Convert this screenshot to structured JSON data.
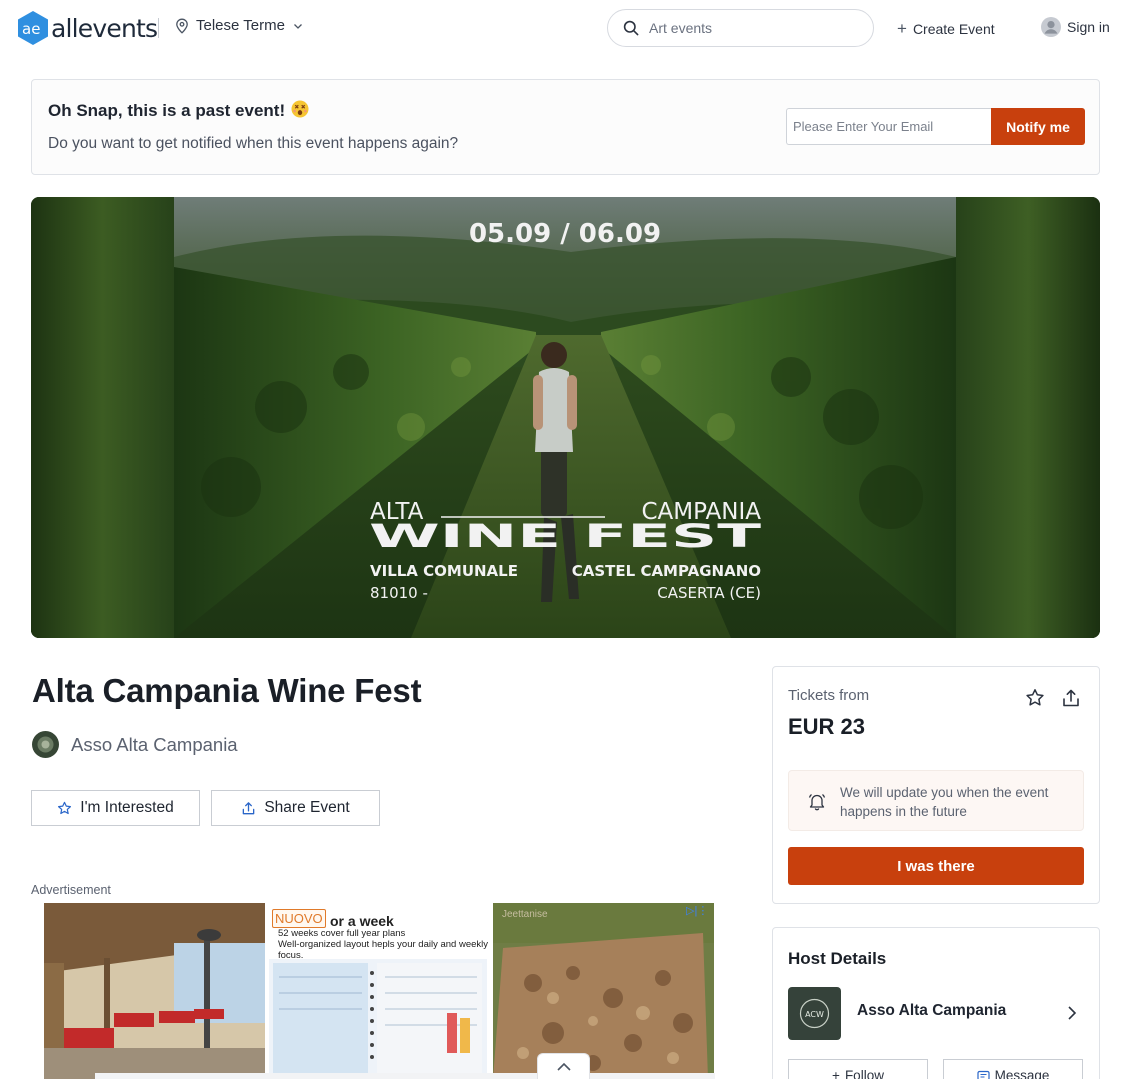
{
  "header": {
    "logo_text": "allevents",
    "location": "Telese Terme",
    "search_placeholder": "Art events",
    "create_event": "Create Event",
    "sign_in": "Sign in"
  },
  "notice": {
    "title": "Oh Snap, this is a past event!",
    "subtitle": "Do you want to get notified when this event happens again?",
    "email_placeholder": "Please Enter Your Email",
    "notify_button": "Notify me"
  },
  "hero": {
    "dates": "05.09 / 06.09",
    "line_left": "ALTA",
    "line_right": "CAMPANIA",
    "big_title": "WINE FEST",
    "venue_left_1": "VILLA COMUNALE",
    "venue_left_2": "81010 -",
    "venue_right_1": "CASTEL CAMPAGNANO",
    "venue_right_2": "CASERTA (CE)"
  },
  "event": {
    "title": "Alta Campania Wine Fest",
    "organizer": "Asso Alta Campania",
    "interested_button": "I'm Interested",
    "share_button": "Share Event"
  },
  "ad": {
    "label": "Advertisement",
    "badge": "NUOVO",
    "headline": "or a week",
    "line2": "52 weeks cover full year plans",
    "line3": "Well-organized layout hepls your daily and weekly focus.",
    "watermark": "Jeettanise"
  },
  "tickets": {
    "from_label": "Tickets from",
    "price": "EUR 23",
    "update_text": "We will update you when the event happens in the future",
    "button": "I was there"
  },
  "host": {
    "title": "Host Details",
    "name": "Asso Alta Campania",
    "follow_button": "Follow",
    "message_button": "Message"
  },
  "colors": {
    "accent": "#c8400d",
    "brand_blue": "#2f8fe0"
  }
}
